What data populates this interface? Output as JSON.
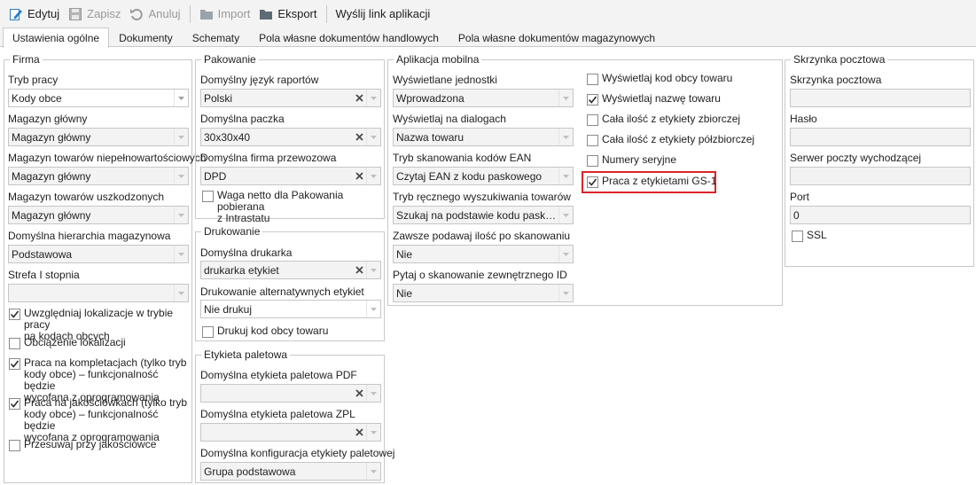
{
  "toolbar": {
    "edit": "Edytuj",
    "save": "Zapisz",
    "cancel": "Anuluj",
    "import": "Import",
    "export": "Eksport",
    "send_link": "Wyślij link aplikacji"
  },
  "tabs": [
    "Ustawienia ogólne",
    "Dokumenty",
    "Schematy",
    "Pola własne dokumentów handlowych",
    "Pola własne dokumentów magazynowych"
  ],
  "firma": {
    "title": "Firma",
    "tryb_pracy_label": "Tryb pracy",
    "tryb_pracy_value": "Kody obce",
    "magazyn_glowny_label": "Magazyn główny",
    "magazyn_glowny_value": "Magazyn główny",
    "magazyn_niepeln_label": "Magazyn towarów niepełnowartościowych",
    "magazyn_niepeln_value": "Magazyn główny",
    "magazyn_uszk_label": "Magazyn towarów uszkodzonych",
    "magazyn_uszk_value": "Magazyn główny",
    "hierarchia_label": "Domyślna hierarchia magazynowa",
    "hierarchia_value": "Podstawowa",
    "strefa_label": "Strefa I stopnia",
    "strefa_value": "",
    "cb1_l1": "Uwzględniaj lokalizacje w trybie pracy",
    "cb1_l2": "na kodach obcych",
    "cb2": "Obciążenie lokalizacji",
    "cb3_l1": "Praca na kompletacjach (tylko tryb",
    "cb3_l2": "kody obce) – funkcjonalność będzie",
    "cb3_l3": "wycofana z oprogramowania",
    "cb4_l1": "Praca na jakościówkach (tylko tryb",
    "cb4_l2": "kody obce) – funkcjonalność będzie",
    "cb4_l3": "wycofana z oprogramowania",
    "cb5": "Przesuwaj przy jakościówce"
  },
  "pakowanie": {
    "title": "Pakowanie",
    "jezyk_label": "Domyślny język raportów",
    "jezyk_value": "Polski",
    "paczka_label": "Domyślna paczka",
    "paczka_value": "30x30x40",
    "firma_label": "Domyślna firma przewozowa",
    "firma_value": "DPD",
    "waga_l1": "Waga netto dla Pakowania pobierana",
    "waga_l2": "z Intrastatu"
  },
  "drukowanie": {
    "title": "Drukowanie",
    "drukarka_label": "Domyślna drukarka",
    "drukarka_value": "drukarka etykiet",
    "alt_label": "Drukowanie alternatywnych etykiet",
    "alt_value": "Nie drukuj",
    "kod_obcy": "Drukuj kod obcy towaru"
  },
  "etykieta": {
    "title": "Etykieta paletowa",
    "pdf_label": "Domyślna etykieta paletowa PDF",
    "pdf_value": "",
    "zpl_label": "Domyślna etykieta paletowa ZPL",
    "zpl_value": "",
    "konf_label": "Domyślna konfiguracja etykiety paletowej",
    "konf_value": "Grupa podstawowa"
  },
  "mobilna": {
    "title": "Aplikacja mobilna",
    "jednostki_label": "Wyświetlane jednostki",
    "jednostki_value": "Wprowadzona",
    "dialogi_label": "Wyświetlaj na dialogach",
    "dialogi_value": "Nazwa towaru",
    "ean_label": "Tryb skanowania kodów EAN",
    "ean_value": "Czytaj EAN z kodu paskowego",
    "reczne_label": "Tryb ręcznego wyszukiwania towarów",
    "reczne_value": "Szukaj na podstawie kodu paskowe...",
    "ilosc_label": "Zawsze podawaj ilość po skanowaniu",
    "ilosc_value": "Nie",
    "id_label": "Pytaj o skanowanie zewnętrznego ID",
    "id_value": "Nie",
    "r1": "Wyświetlaj kod obcy towaru",
    "r2": "Wyświetlaj nazwę towaru",
    "r3": "Cała ilość z etykiety zbiorczej",
    "r4": "Cała ilość z etykiety półzbiorczej",
    "r5": "Numery seryjne",
    "r6": "Praca z etykietami GS-1"
  },
  "skrzynka": {
    "title": "Skrzynka pocztowa",
    "skrzynka_label": "Skrzynka pocztowa",
    "skrzynka_value": "",
    "haslo_label": "Hasło",
    "haslo_value": "",
    "serwer_label": "Serwer poczty wychodzącej",
    "serwer_value": "",
    "port_label": "Port",
    "port_value": "0",
    "ssl": "SSL"
  },
  "colors": {
    "highlight": "#d9252a",
    "edit_icon": "#2d7fc6",
    "folder_icon": "#5f6b76"
  },
  "checks": {
    "firma": [
      true,
      false,
      true,
      true,
      false
    ],
    "waga": false,
    "kod_obcy": false,
    "mobilna": [
      false,
      true,
      false,
      false,
      false,
      true
    ],
    "ssl": false
  }
}
